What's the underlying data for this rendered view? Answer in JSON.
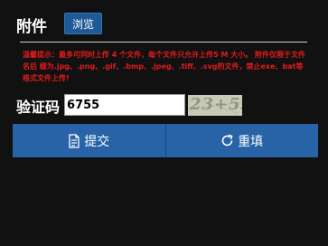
{
  "attachment": {
    "label": "附件",
    "browse_label": "浏览"
  },
  "notice": {
    "text": "温馨提示：最多可同时上传 4 个文件，每个文件只允许上传5 M 大小。 附件仅限于文件名后 缀为.jpg、.png、.gif、.bmp、.jpeg、.tiff、.svg的文件，禁止exe、bat等格式文件上传!"
  },
  "captcha": {
    "label": "验证码",
    "value": "6755",
    "image_text": "23+52"
  },
  "actions": {
    "submit_label": "提交",
    "submit_icon": "document-icon",
    "reset_label": "重填",
    "reset_icon": "refresh-icon"
  },
  "colors": {
    "background": "#111111",
    "notice": "#e21b1b",
    "button": "#2763a6"
  }
}
